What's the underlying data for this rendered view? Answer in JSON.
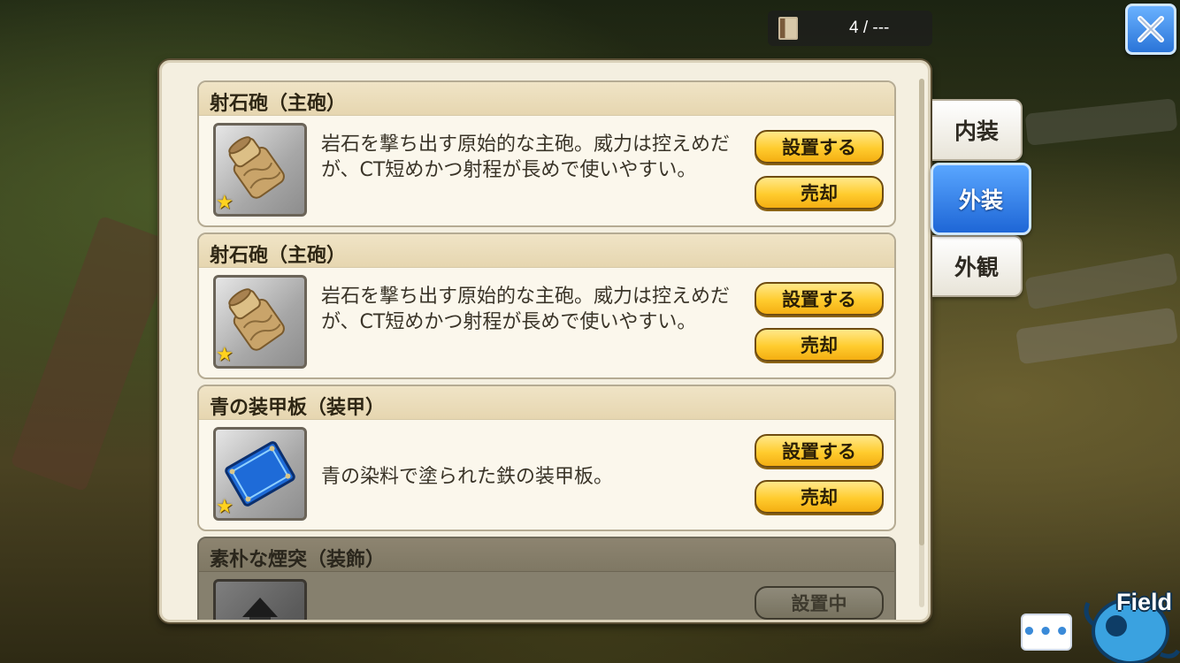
{
  "header": {
    "counter_icon": "book-icon",
    "counter_text": "4 / ---",
    "close_icon": "close-icon"
  },
  "items": [
    {
      "title": "射石砲（主砲）",
      "icon": "stone-cannon-icon",
      "rarity_stars": 1,
      "description": "岩石を撃ち出す原始的な主砲。威力は控えめだが、CT短めかつ射程が長めで使いやすい。",
      "install_label": "設置する",
      "sell_label": "売却"
    },
    {
      "title": "射石砲（主砲）",
      "icon": "stone-cannon-icon",
      "rarity_stars": 1,
      "description": "岩石を撃ち出す原始的な主砲。威力は控えめだが、CT短めかつ射程が長めで使いやすい。",
      "install_label": "設置する",
      "sell_label": "売却"
    },
    {
      "title": "青の装甲板（装甲）",
      "icon": "blue-armor-plate-icon",
      "rarity_stars": 1,
      "description": "青の染料で塗られた鉄の装甲板。",
      "install_label": "設置する",
      "sell_label": "売却"
    },
    {
      "title": "素朴な煙突（装飾）",
      "icon": "chimney-icon",
      "status_label": "設置中"
    }
  ],
  "tabs": [
    {
      "label": "内装",
      "active": false
    },
    {
      "label": "外装",
      "active": true
    },
    {
      "label": "外観",
      "active": false
    }
  ],
  "bottom": {
    "chat_label": "•••",
    "field_label": "Field"
  },
  "colors": {
    "accent_blue": "#2a74d8",
    "button_gold": "#ffcc2e",
    "panel_bg": "#f4efe0"
  }
}
